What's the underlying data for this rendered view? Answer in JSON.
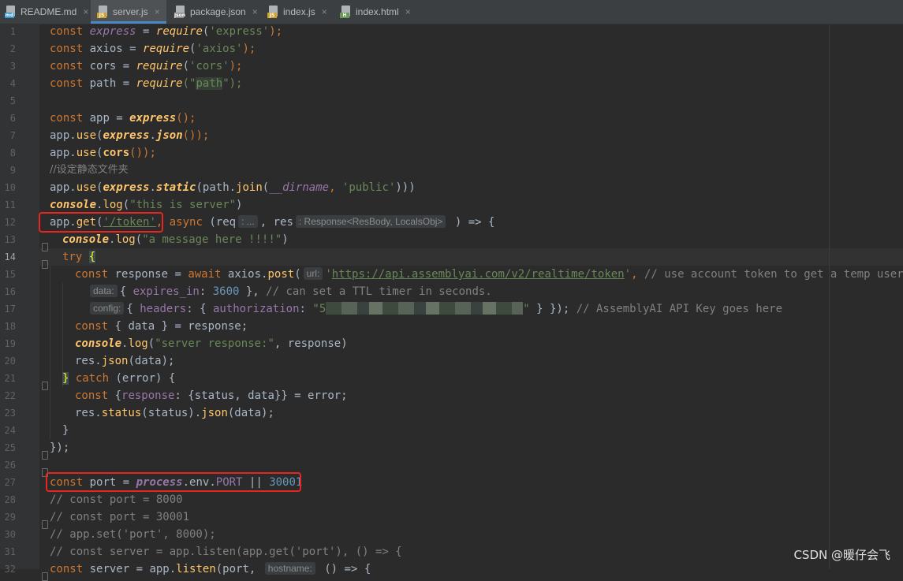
{
  "tabs": [
    {
      "name": "README.md",
      "icon": "md",
      "icon_color": "#3592c4",
      "active": false
    },
    {
      "name": "server.js",
      "icon": "JS",
      "icon_color": "#d0a231",
      "active": true
    },
    {
      "name": "package.json",
      "icon": "json",
      "icon_color": "#8c8c8c",
      "active": false
    },
    {
      "name": "index.js",
      "icon": "JS",
      "icon_color": "#d0a231",
      "active": false
    },
    {
      "name": "index.html",
      "icon": "H",
      "icon_color": "#6a9955",
      "active": false
    }
  ],
  "close_glyph": "×",
  "editor": {
    "current_line": 14,
    "line_numbers": [
      1,
      2,
      3,
      4,
      5,
      6,
      7,
      8,
      9,
      10,
      11,
      12,
      13,
      14,
      15,
      16,
      17,
      18,
      19,
      20,
      21,
      22,
      23,
      24,
      25,
      26,
      27,
      28,
      29,
      30,
      31,
      32
    ]
  },
  "code": {
    "l1": {
      "kw": "const",
      "v": "express",
      "eq": " = ",
      "fn": "require",
      "p1": "(",
      "s": "'express'",
      "p2": ");"
    },
    "l2": {
      "kw": "const",
      "v": " axios = ",
      "fn": "require",
      "p1": "(",
      "s": "'axios'",
      "p2": ");"
    },
    "l3": {
      "kw": "const",
      "v": " cors = ",
      "fn": "require",
      "p1": "(",
      "s": "'cors'",
      "p2": ");"
    },
    "l4": {
      "kw": "const",
      "v": " path = ",
      "fn": "require",
      "p1": "(\"",
      "s": "path",
      "p2": "\");"
    },
    "l6": {
      "kw": "const",
      "v": " app = ",
      "fn": "express",
      "p2": "();"
    },
    "l7": {
      "a": "app.",
      "m": "use",
      "b": "(",
      "fn": "express",
      "c": ".",
      "fn2": "json",
      "d": "());"
    },
    "l8": {
      "a": "app.",
      "m": "use",
      "b": "(",
      "fn": "cors",
      "d": "());"
    },
    "l9": {
      "cm": "//设定静态文件夹"
    },
    "l10": {
      "a": "app.",
      "m": "use",
      "b": "(",
      "fn": "express",
      "c": ".",
      "fn2": "static",
      "d": "(path.",
      "fn3": "join",
      "e": "(",
      "g": "__dirname",
      "h": ", ",
      "s": "'public'",
      "i": ")))"
    },
    "l11": {
      "fn": "console",
      "c": ".",
      "fn2": "log",
      "b": "(",
      "s": "\"this is server\"",
      "d": ")"
    },
    "l12": {
      "a": "app.",
      "m": "get",
      "b": "(",
      "s": "'/token'",
      "h": ", ",
      "kw": "async",
      "c": " (req",
      "hint1": ": ...",
      "d": ", res",
      "hint2": ": Response<ResBody, LocalsObj>",
      "e": " ) => {"
    },
    "l13": {
      "fn": "console",
      "c": ".",
      "fn2": "log",
      "b": "(",
      "s": "\"a message here !!!!\"",
      "d": ")"
    },
    "l14": {
      "kw": "try",
      "sp": " ",
      "br": "{"
    },
    "l15": {
      "kw": "const",
      "a": " response = ",
      "kw2": "await",
      "b": " axios.",
      "fn": "post",
      "c": "(",
      "hint": "url:",
      "s1": "'",
      "url": "https://api.assemblyai.com/v2/realtime/token",
      "s2": "'",
      "d": ", ",
      "cm": "// use account token to get a temp user token"
    },
    "l16": {
      "hint": "data:",
      "a": "{ ",
      "p": "expires_in",
      "b": ": ",
      "n": "3600",
      "c": " }, ",
      "cm": "// can set a TTL timer in seconds."
    },
    "l17": {
      "hint": "config:",
      "a": "{ ",
      "p": "headers",
      "b": ": { ",
      "p2": "authorization",
      "c": ": ",
      "s1": "\"5",
      "s2": "\"",
      "d": " } }); ",
      "cm": "// AssemblyAI API Key goes here"
    },
    "l18": {
      "kw": "const",
      "a": " { data } = response;"
    },
    "l19": {
      "fn": "console",
      "c": ".",
      "fn2": "log",
      "b": "(",
      "s": "\"server response:\"",
      "d": ", response)"
    },
    "l20": {
      "a": "res.",
      "fn": "json",
      "b": "(data);"
    },
    "l21": {
      "br": "}",
      "sp": " ",
      "kw": "catch",
      "a": " (error) {"
    },
    "l22": {
      "kw": "const",
      "a": " {",
      "p": "response",
      "b": ": {status, data}} = error;"
    },
    "l23": {
      "a": "res.",
      "fn": "status",
      "b": "(status).",
      "fn2": "json",
      "c": "(data);"
    },
    "l24": {
      "a": "}"
    },
    "l25": {
      "a": "});"
    },
    "l27": {
      "kw": "const",
      "a": " port = ",
      "i": "process",
      "b": ".env.",
      "p": "PORT",
      "c": " || ",
      "n": "30001"
    },
    "l28": {
      "cm": "// const port = 8000"
    },
    "l29": {
      "cm": "// const port = 30001"
    },
    "l30": {
      "cm": "// app.set('port', 8000);"
    },
    "l31": {
      "cm": "// const server = app.listen(app.get('port'), () => {"
    },
    "l32": {
      "kw": "const",
      "a": " server = app.",
      "fn": "listen",
      "b": "(port, ",
      "hint": "hostname:",
      "c": " () => {"
    }
  },
  "watermark": "CSDN @暖仔会飞"
}
